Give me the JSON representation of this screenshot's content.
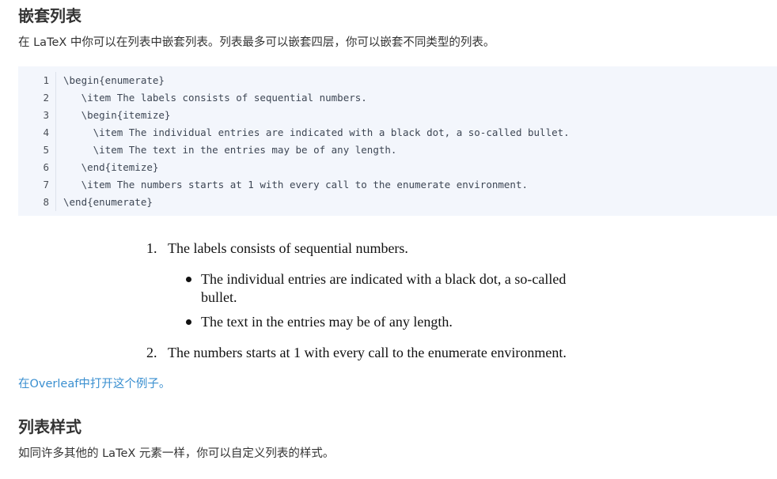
{
  "section1": {
    "heading": "嵌套列表",
    "intro": "在 LaTeX 中你可以在列表中嵌套列表。列表最多可以嵌套四层，你可以嵌套不同类型的列表。"
  },
  "code": {
    "lines": [
      {
        "num": "1",
        "text": "\\begin{enumerate}"
      },
      {
        "num": "2",
        "text": "   \\item The labels consists of sequential numbers."
      },
      {
        "num": "3",
        "text": "   \\begin{itemize}"
      },
      {
        "num": "4",
        "text": "     \\item The individual entries are indicated with a black dot, a so-called bullet."
      },
      {
        "num": "5",
        "text": "     \\item The text in the entries may be of any length."
      },
      {
        "num": "6",
        "text": "   \\end{itemize}"
      },
      {
        "num": "7",
        "text": "   \\item The numbers starts at 1 with every call to the enumerate environment."
      },
      {
        "num": "8",
        "text": "\\end{enumerate}"
      }
    ]
  },
  "rendered": {
    "item1_marker": "1.",
    "item1_text": "The labels consists of sequential numbers.",
    "bullet1_line1": "The  individual  entries  are  indicated  with  a  black  dot,  a  so-called",
    "bullet1_line2": "bullet.",
    "bullet2_text": "The text in the entries may be of any length.",
    "item2_marker": "2.",
    "item2_text": "The numbers starts at 1 with every call to the enumerate environment."
  },
  "overleaf_link": "在Overleaf中打开这个例子。",
  "section2": {
    "heading": "列表样式",
    "intro": "如同许多其他的 LaTeX 元素一样，你可以自定义列表的样式。"
  },
  "colors": {
    "code_background": "#f3f6fc",
    "link": "#3a8fd0",
    "heading": "#333333"
  }
}
